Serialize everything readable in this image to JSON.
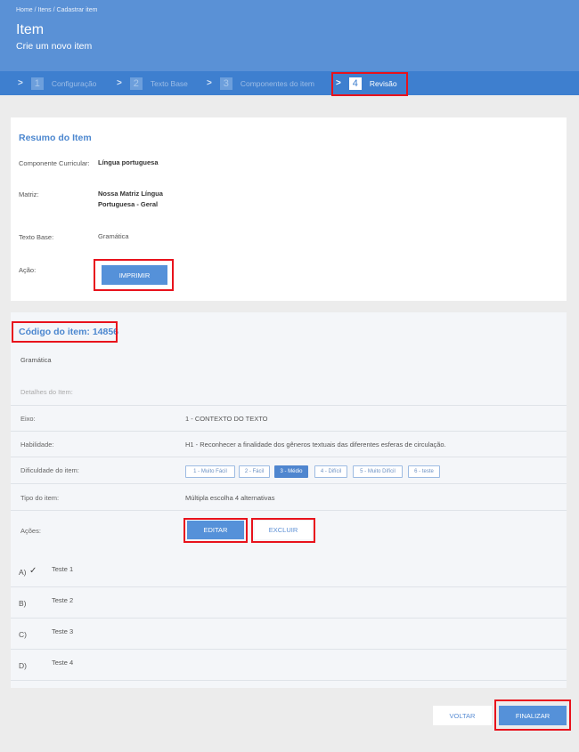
{
  "header": {
    "breadcrumb": "Home / Itens / Cadastrar item",
    "title": "Item",
    "subtitle": "Crie um novo item"
  },
  "steps": [
    {
      "num": "1",
      "label": "Configuração"
    },
    {
      "num": "2",
      "label": "Texto Base"
    },
    {
      "num": "3",
      "label": "Componentes do item"
    },
    {
      "num": "4",
      "label": "Revisão"
    }
  ],
  "resumo": {
    "title": "Resumo do Item",
    "componente_label": "Componente Curricular:",
    "componente_value": "Língua portuguesa",
    "matriz_label": "Matriz:",
    "matriz_line1": "Nossa Matriz Língua",
    "matriz_line2": "Portuguesa - Geral",
    "texto_base_label": "Texto Base:",
    "texto_base_value": "Gramática",
    "acao_label": "Ação:",
    "imprimir_label": "IMPRIMIR"
  },
  "item": {
    "code_title": "Código do item: 14856",
    "subject": "Gramática",
    "detalhes_label": "Detalhes do Item:",
    "eixo_label": "Eixo:",
    "eixo_value": "1 - CONTEXTO DO TEXTO",
    "habilidade_label": "Habilidade:",
    "habilidade_value": "H1 - Reconhecer a finalidade dos gêneros textuais das diferentes esferas de circulação.",
    "dificuldade_label": "Dificuldade do item:",
    "dificuldades": [
      "1 - Muito Fácil",
      "2 - Fácil",
      "3 - Médio",
      "4 - Difícil",
      "5 - Muito Difícil",
      "6 - teste"
    ],
    "dificuldade_selected": "3 - Médio",
    "tipo_label": "Tipo do item:",
    "tipo_value": "Múltipla escolha 4 alternativas",
    "acoes_label": "Ações:",
    "editar_label": "EDITAR",
    "excluir_label": "EXCLUIR",
    "alternativas": [
      {
        "letter": "A)",
        "text": "Teste 1",
        "correct": true
      },
      {
        "letter": "B)",
        "text": "Teste 2",
        "correct": false
      },
      {
        "letter": "C)",
        "text": "Teste 3",
        "correct": false
      },
      {
        "letter": "D)",
        "text": "Teste 4",
        "correct": false
      }
    ]
  },
  "footer": {
    "voltar_label": "VOLTAR",
    "finalizar_label": "FINALIZAR"
  },
  "colors": {
    "header": "#5a91d6",
    "stepsbar": "#3e7fcf",
    "primary": "#5591d9",
    "highlight": "#e8121c"
  },
  "icons": {
    "chevron": "chevron-right-icon",
    "check": "check-icon"
  }
}
